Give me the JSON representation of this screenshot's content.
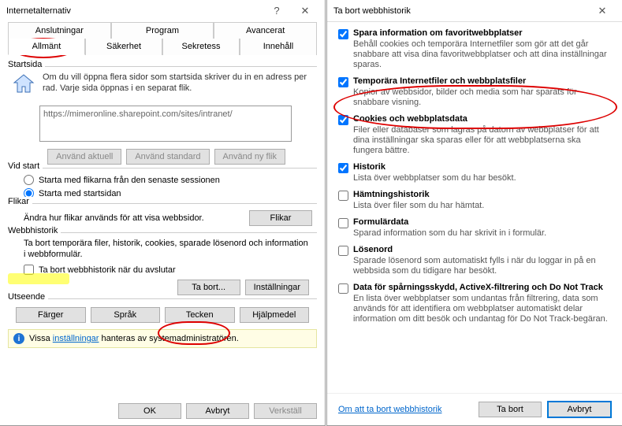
{
  "left": {
    "title": "Internetalternativ",
    "help_glyph": "?",
    "close_glyph": "✕",
    "tabs_row1": [
      "Anslutningar",
      "Program",
      "Avancerat"
    ],
    "tabs_row2": [
      "Allmänt",
      "Säkerhet",
      "Sekretess",
      "Innehåll"
    ],
    "startsida": {
      "label": "Startsida",
      "desc": "Om du vill öppna flera sidor som startsida skriver du in en adress per rad. Varje sida öppnas i en separat flik.",
      "url": "https://mimeronline.sharepoint.com/sites/intranet/",
      "btn_current": "Använd aktuell",
      "btn_default": "Använd standard",
      "btn_newtab": "Använd ny flik"
    },
    "vidstart": {
      "label": "Vid start",
      "opt_session": "Starta med flikarna från den senaste sessionen",
      "opt_home": "Starta med startsidan"
    },
    "flikar": {
      "label": "Flikar",
      "desc": "Ändra hur flikar används för att visa webbsidor.",
      "btn": "Flikar"
    },
    "historik": {
      "label": "Webbhistorik",
      "desc": "Ta bort temporära filer, historik, cookies, sparade lösenord och information i webbformulär.",
      "chk": "Ta bort webbhistorik när du avslutar",
      "btn_delete": "Ta bort...",
      "btn_settings": "Inställningar"
    },
    "utseende": {
      "label": "Utseende",
      "btn_colors": "Färger",
      "btn_lang": "Språk",
      "btn_fonts": "Tecken",
      "btn_access": "Hjälpmedel"
    },
    "info_prefix": "Vissa ",
    "info_link": "inställningar",
    "info_suffix": " hanteras av systemadministratören.",
    "ok": "OK",
    "cancel": "Avbryt",
    "apply": "Verkställ"
  },
  "right": {
    "title": "Ta bort webbhistorik",
    "close_glyph": "✕",
    "opts": [
      {
        "checked": true,
        "label": "Spara information om favoritwebbplatser",
        "sub": "Behåll cookies och temporära Internetfiler som gör att det går snabbare att visa dina favoritwebbplatser och att dina inställningar sparas."
      },
      {
        "checked": true,
        "label": "Temporära Internetfiler och webbplatsfiler",
        "sub": "Kopior av webbsidor, bilder och media som har sparats för snabbare visning."
      },
      {
        "checked": true,
        "label": "Cookies och webbplatsdata",
        "sub": "Filer eller databaser som lagras på datorn av webbplatser för att dina inställningar ska sparas eller för att webbplatserna ska fungera bättre."
      },
      {
        "checked": true,
        "label": "Historik",
        "sub": "Lista över webbplatser som du har besökt."
      },
      {
        "checked": false,
        "label": "Hämtningshistorik",
        "sub": "Lista över filer som du har hämtat."
      },
      {
        "checked": false,
        "label": "Formulärdata",
        "sub": "Sparad information som du har skrivit in i formulär."
      },
      {
        "checked": false,
        "label": "Lösenord",
        "sub": "Sparade lösenord som automatiskt fylls i när du loggar in på en webbsida som du tidigare har besökt."
      },
      {
        "checked": false,
        "label": "Data för spårningsskydd, ActiveX-filtrering och Do Not Track",
        "sub": "En lista över webbplatser som undantas från filtrering, data som används för att identifiera om webbplatser automatiskt delar information om ditt besök och undantag för Do Not Track-begäran."
      }
    ],
    "about_link": "Om att ta bort webbhistorik",
    "btn_delete": "Ta bort",
    "btn_cancel": "Avbryt"
  }
}
